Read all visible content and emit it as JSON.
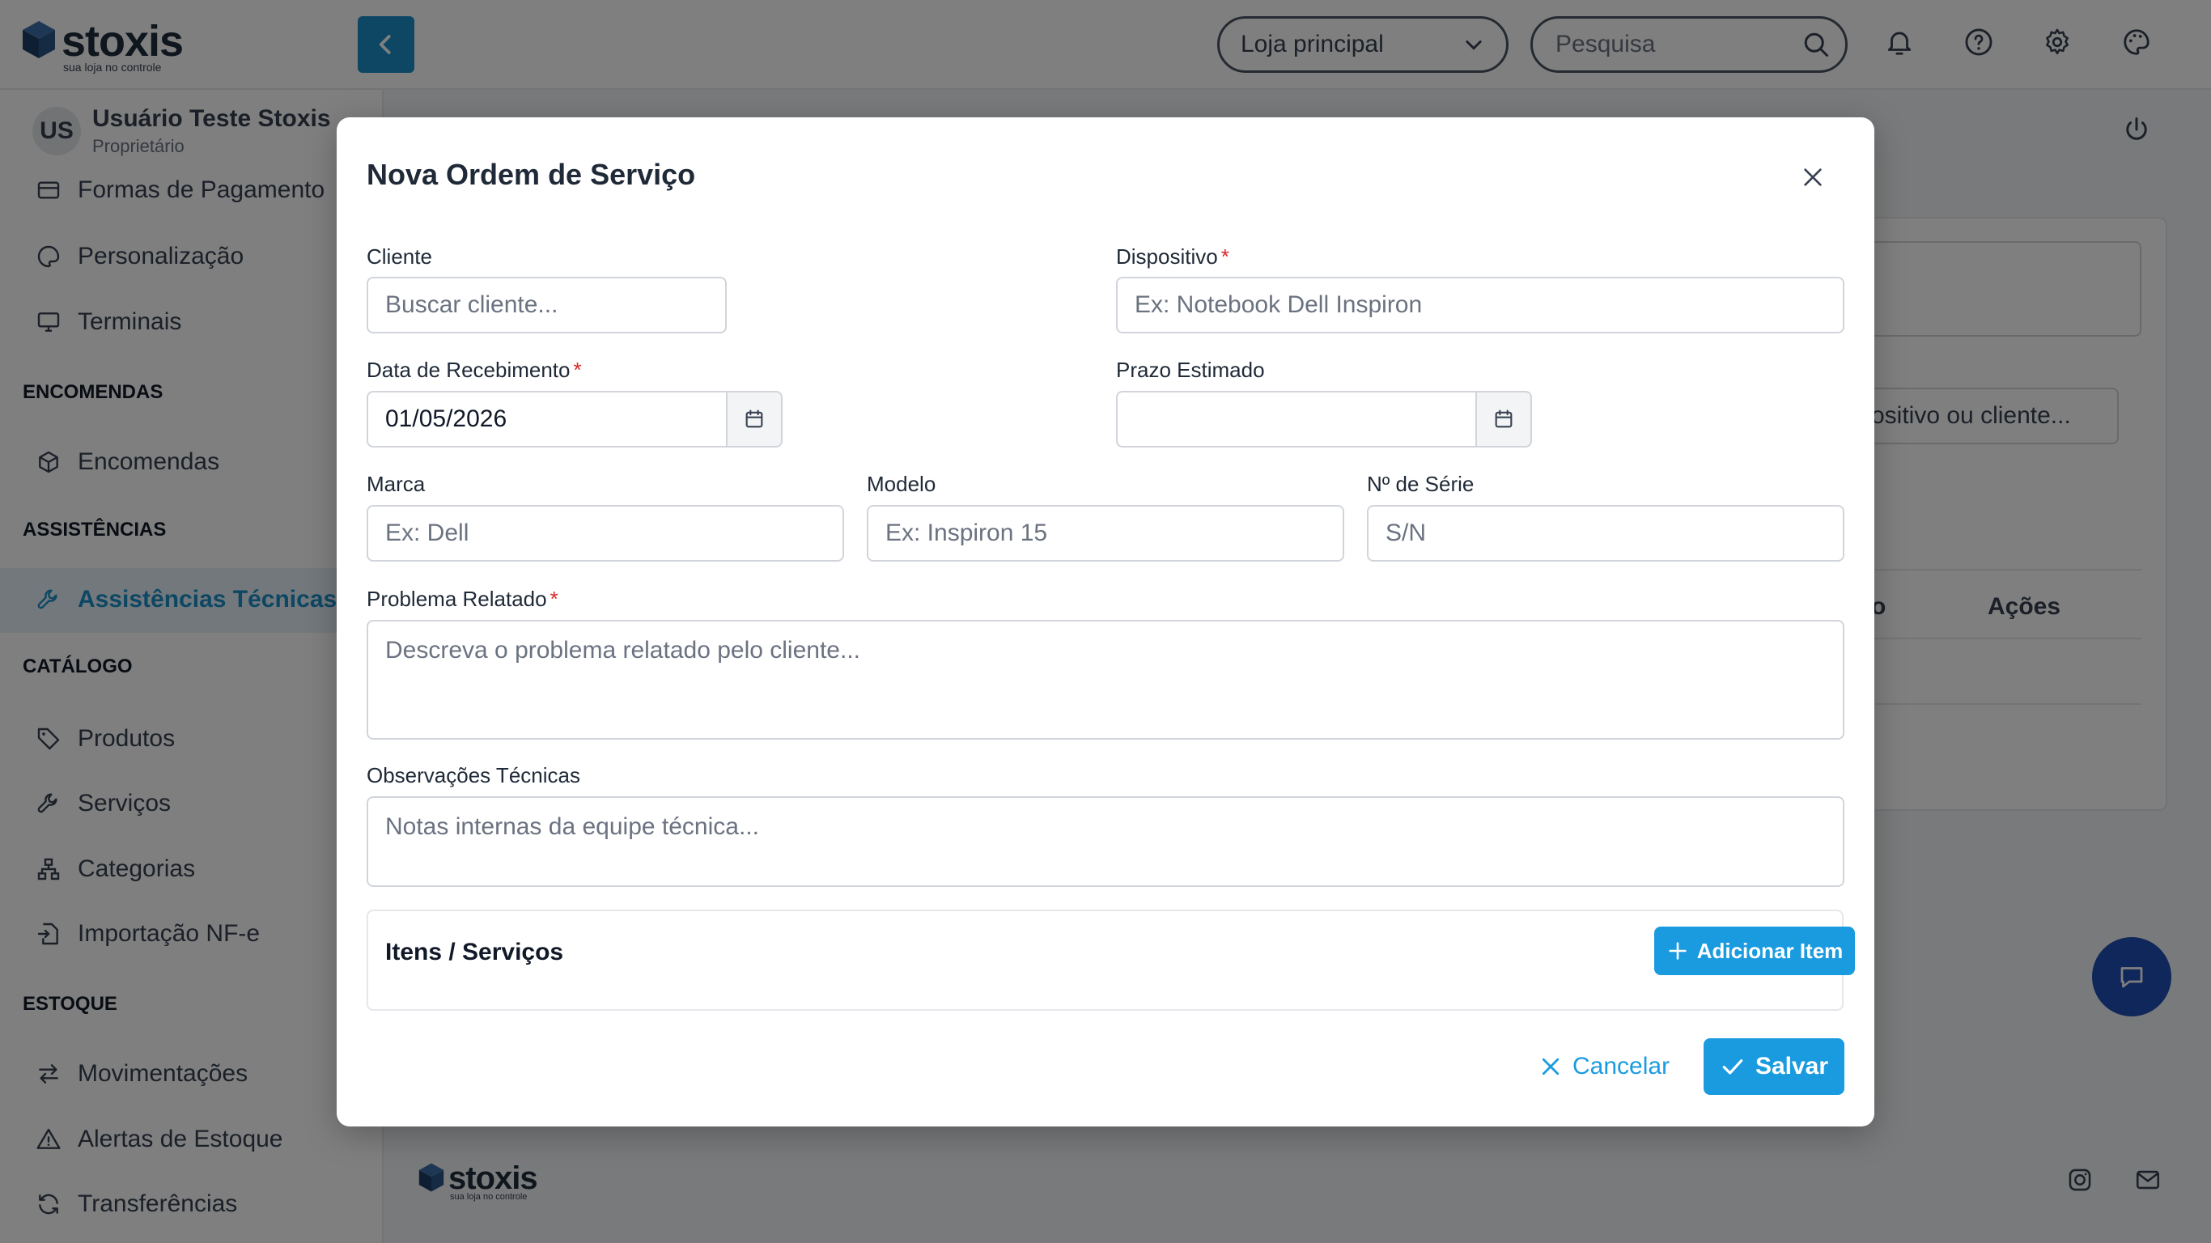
{
  "app": {
    "name": "stoxis",
    "tagline": "sua loja no controle"
  },
  "topbar": {
    "store_select": "Loja principal",
    "search_placeholder": "Pesquisa"
  },
  "user": {
    "initials": "US",
    "name": "Usuário Teste Stoxis",
    "role": "Proprietário"
  },
  "sidebar": {
    "items_top": [
      {
        "label": "Formas de Pagamento",
        "icon": "credit-card-icon"
      },
      {
        "label": "Personalização",
        "icon": "palette-icon"
      },
      {
        "label": "Terminais",
        "icon": "monitor-icon"
      }
    ],
    "sections": {
      "encomendas": "ENCOMENDAS",
      "assistencias": "ASSISTÊNCIAS",
      "catalogo": "CATÁLOGO",
      "estoque": "ESTOQUE"
    },
    "encomendas": "Encomendas",
    "assistencias_tecnicas": "Assistências Técnicas",
    "catalogo_items": [
      "Produtos",
      "Serviços",
      "Categorias",
      "Importação NF-e"
    ],
    "estoque_items": [
      "Movimentações",
      "Alertas de Estoque",
      "Transferências"
    ]
  },
  "background": {
    "search_suffix": "ositivo ou cliente...",
    "col_partial": "o",
    "col_actions": "Ações"
  },
  "modal": {
    "title": "Nova Ordem de Serviço",
    "cliente": {
      "label": "Cliente",
      "placeholder": "Buscar cliente..."
    },
    "dispositivo": {
      "label": "Dispositivo",
      "required": "*",
      "placeholder": "Ex: Notebook Dell Inspiron"
    },
    "data_recebimento": {
      "label": "Data de Recebimento",
      "required": "*",
      "value": "01/05/2026"
    },
    "prazo_estimado": {
      "label": "Prazo Estimado",
      "value": ""
    },
    "marca": {
      "label": "Marca",
      "placeholder": "Ex: Dell"
    },
    "modelo": {
      "label": "Modelo",
      "placeholder": "Ex: Inspiron 15"
    },
    "serie": {
      "label": "Nº de Série",
      "placeholder": "S/N"
    },
    "problema": {
      "label": "Problema Relatado",
      "required": "*",
      "placeholder": "Descreva o problema relatado pelo cliente..."
    },
    "observacoes": {
      "label": "Observações Técnicas",
      "placeholder": "Notas internas da equipe técnica..."
    },
    "items_title": "Itens / Serviços",
    "add_item_label": "Adicionar Item",
    "cancel_label": "Cancelar",
    "save_label": "Salvar"
  },
  "colors": {
    "accent": "#1a9be0",
    "active_bg": "#e6f1f8",
    "required": "#dc2626",
    "chat_fab": "#1e4fb5"
  }
}
